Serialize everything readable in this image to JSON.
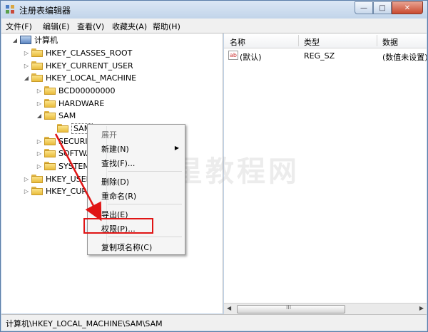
{
  "window": {
    "title": "注册表编辑器",
    "buttons": {
      "minimize": "—",
      "maximize": "□",
      "close": "✕"
    }
  },
  "menubar": [
    {
      "label": "文件(F)"
    },
    {
      "label": "编辑(E)"
    },
    {
      "label": "查看(V)"
    },
    {
      "label": "收藏夹(A)"
    },
    {
      "label": "帮助(H)"
    }
  ],
  "tree": [
    {
      "label": "计算机",
      "arrow": "◢",
      "icon": "computer"
    },
    {
      "label": "HKEY_CLASSES_ROOT",
      "arrow": "▷",
      "icon": "folder"
    },
    {
      "label": "HKEY_CURRENT_USER",
      "arrow": "▷",
      "icon": "folder"
    },
    {
      "label": "HKEY_LOCAL_MACHINE",
      "arrow": "◢",
      "icon": "folder"
    },
    {
      "label": "BCD00000000",
      "arrow": "▷",
      "icon": "folder"
    },
    {
      "label": "HARDWARE",
      "arrow": "▷",
      "icon": "folder"
    },
    {
      "label": "SAM",
      "arrow": "◢",
      "icon": "folder"
    },
    {
      "label": "SAM",
      "arrow": "",
      "icon": "folder",
      "selected": true
    },
    {
      "label": "SECURITY",
      "arrow": "▷",
      "icon": "folder"
    },
    {
      "label": "SOFTWARE",
      "arrow": "▷",
      "icon": "folder"
    },
    {
      "label": "SYSTEM",
      "arrow": "▷",
      "icon": "folder"
    },
    {
      "label": "HKEY_USERS",
      "arrow": "▷",
      "icon": "folder"
    },
    {
      "label": "HKEY_CURRENT_CONFIG",
      "arrow": "▷",
      "icon": "folder"
    }
  ],
  "list": {
    "columns": [
      "名称",
      "类型",
      "数据"
    ],
    "rows": [
      {
        "icon": "ab",
        "name": "(默认)",
        "type": "REG_SZ",
        "data": "(数值未设置)"
      }
    ]
  },
  "scrollbar": {
    "grip": "III"
  },
  "context_menu": {
    "items": [
      {
        "label": "展开",
        "disabled": true
      },
      {
        "label": "新建(N)",
        "submenu": "▶"
      },
      {
        "label": "查找(F)..."
      },
      {
        "label": "删除(D)"
      },
      {
        "label": "重命名(R)"
      },
      {
        "label": "导出(E)"
      },
      {
        "label": "权限(P)...",
        "highlighted": true
      },
      {
        "label": "复制项名称(C)"
      }
    ]
  },
  "status": {
    "path": "计算机\\HKEY_LOCAL_MACHINE\\SAM\\SAM"
  },
  "watermark": "木星教程网",
  "colors": {
    "annotation": "#e01414",
    "title_gradient": "#c3d5ea"
  }
}
